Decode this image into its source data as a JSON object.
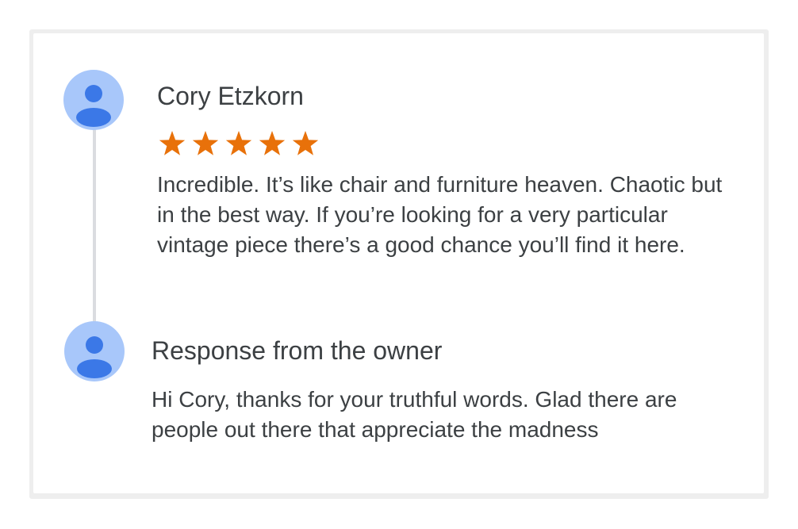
{
  "review": {
    "reviewer_name": "Cory Etzkorn",
    "rating": 5,
    "rating_max": 5,
    "star_color": "#e8710a",
    "text": "Incredible. It’s like chair and furniture heaven. Chaotic but in the best way. If you’re looking for a very particular vintage piece there’s a good chance you’ll find it here.",
    "avatar_icon": "person-icon"
  },
  "owner_response": {
    "heading": "Response from the owner",
    "text": "Hi Cory, thanks for your truthful words. Glad there are people out there that appreciate the madness",
    "avatar_icon": "person-icon"
  },
  "colors": {
    "avatar_background": "#a8c7fa",
    "avatar_figure": "#3b78e7",
    "timeline": "#dadce0",
    "text": "#3c4043"
  }
}
